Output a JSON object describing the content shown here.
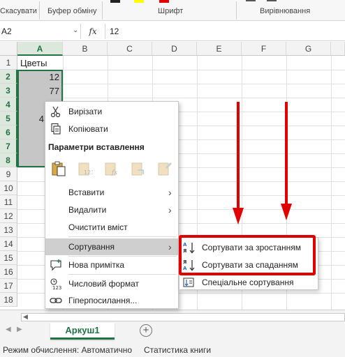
{
  "ribbon": {
    "groups": [
      "Скасувати",
      "Буфер обміну",
      "Шрифт",
      "Вирівнювання"
    ],
    "font_colors": [
      "#ffff00",
      "#e00000"
    ]
  },
  "formula_bar": {
    "name_box": "A2",
    "fx_label": "fx",
    "value": "12"
  },
  "grid": {
    "columns": [
      "A",
      "B",
      "C",
      "D",
      "E",
      "F",
      "G"
    ],
    "rows": [
      "1",
      "2",
      "3",
      "4",
      "5",
      "6",
      "7",
      "8",
      "9",
      "10",
      "11",
      "12",
      "13",
      "14",
      "15",
      "16",
      "17",
      "18"
    ],
    "cells": {
      "A1": "Цветы",
      "A2": "12",
      "A3": "77",
      "A5": "4"
    }
  },
  "context_menu": {
    "cut": "Вирізати",
    "copy": "Копіювати",
    "paste_options_heading": "Параметри вставлення",
    "insert": "Вставити",
    "delete": "Видалити",
    "clear": "Очистити вміст",
    "sort": "Сортування",
    "new_note": "Нова примітка",
    "number_format": "Числовий формат",
    "hyperlink": "Гіперпосилання..."
  },
  "sort_submenu": {
    "ascending": "Сортувати за зростанням",
    "descending": "Сортувати за спаданням",
    "custom": "Спеціальне сортування"
  },
  "sheet_tabs": {
    "active": "Аркуш1",
    "add_label": "+"
  },
  "status_bar": {
    "calc_mode": "Режим обчислення: Автоматично",
    "stats": "Статистика книги"
  },
  "colors": {
    "excel_green": "#217346",
    "annotation_red": "#e00000"
  }
}
